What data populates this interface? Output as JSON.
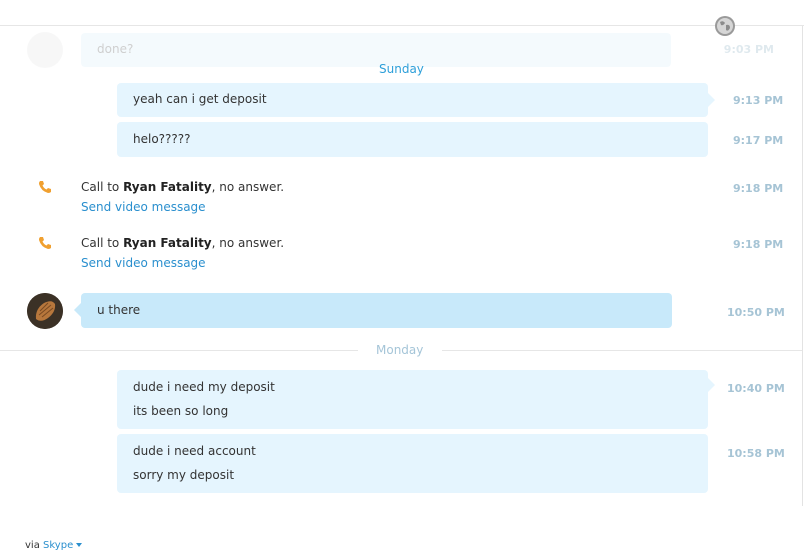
{
  "top_faded": {
    "message": "done?",
    "time": "9:03 PM"
  },
  "days": {
    "sunday": "Sunday",
    "monday": "Monday"
  },
  "messages": [
    {
      "text": "yeah can i get deposit",
      "time": "9:13 PM"
    },
    {
      "text": "helo?????",
      "time": "9:17 PM"
    }
  ],
  "calls": [
    {
      "prefix": "Call to ",
      "name": "Ryan Fatality",
      "suffix": ", no answer.",
      "link": "Send video message",
      "time": "9:18 PM"
    },
    {
      "prefix": "Call to ",
      "name": "Ryan Fatality",
      "suffix": ", no answer.",
      "link": "Send video message",
      "time": "9:18 PM"
    }
  ],
  "incoming": {
    "text": "u there",
    "time": "10:50 PM"
  },
  "monday_messages": [
    {
      "lines": [
        "dude i need my deposit",
        "its been so long"
      ],
      "time": "10:40 PM"
    },
    {
      "lines": [
        "dude i need account",
        "sorry my deposit"
      ],
      "time": "10:58 PM"
    }
  ],
  "footer": {
    "via": "via ",
    "service": "Skype"
  },
  "colors": {
    "accent": "#2a8fce",
    "bubble_out": "#e5f5fe",
    "bubble_in": "#c8e9fa",
    "call_icon": "#f0a030"
  }
}
